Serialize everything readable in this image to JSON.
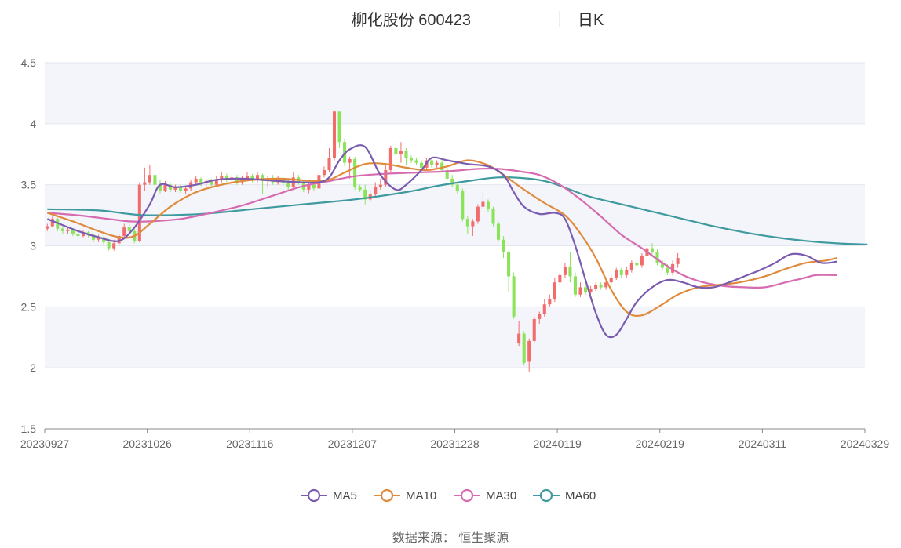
{
  "title": {
    "name": "柳化股份 600423",
    "period": "日K"
  },
  "source_text": "数据来源： 恒生聚源",
  "colors": {
    "up": "#F26C6C",
    "down": "#8BE35A",
    "ma5": "#7A5BB0",
    "ma10": "#E08A3C",
    "ma30": "#D66BB0",
    "ma60": "#3E9A9E",
    "band": "#F3F5FA",
    "grid": "#E2E6EE",
    "axis": "#888888"
  },
  "chart_data": {
    "type": "candlestick",
    "ylim": [
      1.5,
      4.5
    ],
    "yticks": [
      "1.5",
      "2",
      "2.5",
      "3",
      "3.5",
      "4",
      "4.5"
    ],
    "ytick_values": [
      1.5,
      2,
      2.5,
      3,
      3.5,
      4,
      4.5
    ],
    "xticks": [
      "20230927",
      "20231026",
      "20231116",
      "20231207",
      "20231228",
      "20240119",
      "20240219",
      "20240311",
      "20240329"
    ],
    "xtick_index": [
      0,
      20,
      40,
      60,
      80,
      100,
      120,
      140,
      160
    ],
    "legend": [
      "MA5",
      "MA10",
      "MA30",
      "MA60"
    ],
    "candles": [
      [
        3.14,
        3.16,
        3.12,
        3.18
      ],
      [
        3.16,
        3.22,
        3.15,
        3.24
      ],
      [
        3.22,
        3.14,
        3.12,
        3.23
      ],
      [
        3.14,
        3.12,
        3.1,
        3.16
      ],
      [
        3.12,
        3.13,
        3.1,
        3.15
      ],
      [
        3.13,
        3.1,
        3.08,
        3.14
      ],
      [
        3.1,
        3.08,
        3.06,
        3.12
      ],
      [
        3.08,
        3.11,
        3.07,
        3.13
      ],
      [
        3.11,
        3.09,
        3.07,
        3.12
      ],
      [
        3.09,
        3.05,
        3.03,
        3.1
      ],
      [
        3.05,
        3.07,
        3.03,
        3.09
      ],
      [
        3.07,
        3.03,
        3.01,
        3.08
      ],
      [
        3.03,
        2.98,
        2.96,
        3.05
      ],
      [
        2.98,
        3.02,
        2.96,
        3.05
      ],
      [
        3.02,
        3.08,
        3.0,
        3.1
      ],
      [
        3.08,
        3.15,
        3.06,
        3.18
      ],
      [
        3.15,
        3.12,
        3.1,
        3.18
      ],
      [
        3.12,
        3.04,
        3.02,
        3.14
      ],
      [
        3.04,
        3.5,
        3.03,
        3.52
      ],
      [
        3.5,
        3.52,
        3.45,
        3.64
      ],
      [
        3.52,
        3.58,
        3.5,
        3.66
      ],
      [
        3.58,
        3.5,
        3.48,
        3.62
      ],
      [
        3.5,
        3.45,
        3.43,
        3.54
      ],
      [
        3.45,
        3.5,
        3.44,
        3.53
      ],
      [
        3.5,
        3.46,
        3.44,
        3.52
      ],
      [
        3.46,
        3.48,
        3.44,
        3.5
      ],
      [
        3.48,
        3.45,
        3.43,
        3.5
      ],
      [
        3.45,
        3.47,
        3.42,
        3.49
      ],
      [
        3.47,
        3.52,
        3.45,
        3.54
      ],
      [
        3.52,
        3.55,
        3.5,
        3.57
      ],
      [
        3.55,
        3.51,
        3.49,
        3.56
      ],
      [
        3.51,
        3.53,
        3.49,
        3.55
      ],
      [
        3.53,
        3.5,
        3.48,
        3.55
      ],
      [
        3.5,
        3.54,
        3.49,
        3.57
      ],
      [
        3.54,
        3.57,
        3.52,
        3.6
      ],
      [
        3.57,
        3.54,
        3.52,
        3.59
      ],
      [
        3.54,
        3.56,
        3.52,
        3.58
      ],
      [
        3.56,
        3.52,
        3.5,
        3.58
      ],
      [
        3.52,
        3.55,
        3.5,
        3.57
      ],
      [
        3.55,
        3.57,
        3.53,
        3.6
      ],
      [
        3.57,
        3.54,
        3.52,
        3.59
      ],
      [
        3.54,
        3.58,
        3.52,
        3.6
      ],
      [
        3.58,
        3.53,
        3.42,
        3.59
      ],
      [
        3.53,
        3.55,
        3.48,
        3.57
      ],
      [
        3.55,
        3.52,
        3.5,
        3.58
      ],
      [
        3.52,
        3.55,
        3.5,
        3.57
      ],
      [
        3.55,
        3.51,
        3.49,
        3.56
      ],
      [
        3.51,
        3.48,
        3.46,
        3.54
      ],
      [
        3.48,
        3.56,
        3.46,
        3.6
      ],
      [
        3.56,
        3.52,
        3.5,
        3.58
      ],
      [
        3.52,
        3.46,
        3.44,
        3.54
      ],
      [
        3.46,
        3.5,
        3.43,
        3.52
      ],
      [
        3.5,
        3.47,
        3.45,
        3.53
      ],
      [
        3.47,
        3.58,
        3.46,
        3.6
      ],
      [
        3.58,
        3.62,
        3.56,
        3.65
      ],
      [
        3.62,
        3.72,
        3.6,
        3.8
      ],
      [
        3.72,
        4.1,
        3.7,
        4.11
      ],
      [
        4.1,
        3.85,
        3.8,
        4.1
      ],
      [
        3.85,
        3.68,
        3.65,
        3.88
      ],
      [
        3.68,
        3.71,
        3.55,
        3.73
      ],
      [
        3.71,
        3.48,
        3.46,
        3.73
      ],
      [
        3.48,
        3.46,
        3.44,
        3.5
      ],
      [
        3.46,
        3.38,
        3.34,
        3.5
      ],
      [
        3.38,
        3.42,
        3.36,
        3.45
      ],
      [
        3.42,
        3.48,
        3.4,
        3.52
      ],
      [
        3.48,
        3.5,
        3.46,
        3.55
      ],
      [
        3.5,
        3.62,
        3.48,
        3.66
      ],
      [
        3.62,
        3.8,
        3.6,
        3.82
      ],
      [
        3.8,
        3.75,
        3.74,
        3.85
      ],
      [
        3.75,
        3.78,
        3.68,
        3.85
      ],
      [
        3.78,
        3.72,
        3.66,
        3.8
      ],
      [
        3.72,
        3.7,
        3.68,
        3.74
      ],
      [
        3.7,
        3.68,
        3.66,
        3.72
      ],
      [
        3.68,
        3.64,
        3.62,
        3.7
      ],
      [
        3.64,
        3.7,
        3.62,
        3.72
      ],
      [
        3.7,
        3.66,
        3.64,
        3.72
      ],
      [
        3.66,
        3.68,
        3.64,
        3.7
      ],
      [
        3.68,
        3.62,
        3.6,
        3.7
      ],
      [
        3.62,
        3.55,
        3.53,
        3.64
      ],
      [
        3.55,
        3.5,
        3.48,
        3.58
      ],
      [
        3.5,
        3.45,
        3.43,
        3.52
      ],
      [
        3.45,
        3.22,
        3.2,
        3.47
      ],
      [
        3.22,
        3.16,
        3.1,
        3.24
      ],
      [
        3.16,
        3.2,
        3.08,
        3.22
      ],
      [
        3.2,
        3.32,
        3.18,
        3.34
      ],
      [
        3.32,
        3.36,
        3.3,
        3.45
      ],
      [
        3.36,
        3.3,
        3.28,
        3.38
      ],
      [
        3.3,
        3.18,
        3.16,
        3.32
      ],
      [
        3.18,
        3.05,
        3.03,
        3.2
      ],
      [
        3.05,
        2.95,
        2.9,
        3.08
      ],
      [
        2.95,
        2.75,
        2.62,
        2.96
      ],
      [
        2.75,
        2.42,
        2.4,
        2.78
      ],
      [
        2.2,
        2.28,
        2.18,
        2.38
      ],
      [
        2.28,
        2.04,
        2.02,
        2.3
      ],
      [
        2.05,
        2.22,
        1.97,
        2.24
      ],
      [
        2.22,
        2.4,
        2.2,
        2.42
      ],
      [
        2.4,
        2.44,
        2.36,
        2.46
      ],
      [
        2.44,
        2.52,
        2.42,
        2.56
      ],
      [
        2.52,
        2.56,
        2.5,
        2.6
      ],
      [
        2.56,
        2.7,
        2.54,
        2.74
      ],
      [
        2.7,
        2.76,
        2.68,
        2.78
      ],
      [
        2.76,
        2.83,
        2.74,
        2.86
      ],
      [
        2.83,
        2.75,
        2.7,
        2.95
      ],
      [
        2.75,
        2.6,
        2.58,
        2.78
      ],
      [
        2.6,
        2.66,
        2.58,
        2.7
      ],
      [
        2.66,
        2.62,
        2.6,
        2.68
      ],
      [
        2.62,
        2.65,
        2.6,
        2.67
      ],
      [
        2.65,
        2.68,
        2.63,
        2.7
      ],
      [
        2.68,
        2.66,
        2.64,
        2.7
      ],
      [
        2.66,
        2.7,
        2.64,
        2.72
      ],
      [
        2.7,
        2.74,
        2.68,
        2.77
      ],
      [
        2.74,
        2.8,
        2.72,
        2.82
      ],
      [
        2.8,
        2.76,
        2.74,
        2.82
      ],
      [
        2.76,
        2.8,
        2.74,
        2.83
      ],
      [
        2.8,
        2.86,
        2.78,
        2.88
      ],
      [
        2.86,
        2.84,
        2.82,
        2.89
      ],
      [
        2.84,
        2.92,
        2.82,
        2.94
      ],
      [
        2.92,
        2.98,
        2.9,
        3.0
      ],
      [
        2.98,
        2.95,
        2.92,
        3.02
      ],
      [
        2.95,
        2.86,
        2.84,
        2.97
      ],
      [
        2.86,
        2.82,
        2.8,
        2.88
      ],
      [
        2.82,
        2.78,
        2.76,
        2.85
      ],
      [
        2.78,
        2.85,
        2.76,
        2.88
      ],
      [
        2.85,
        2.9,
        2.82,
        2.94
      ]
    ],
    "ma5": [
      [
        0,
        3.22
      ],
      [
        6,
        3.12
      ],
      [
        10,
        3.07
      ],
      [
        14,
        3.04
      ],
      [
        17,
        3.15
      ],
      [
        20,
        3.34
      ],
      [
        22,
        3.5
      ],
      [
        25,
        3.48
      ],
      [
        29,
        3.5
      ],
      [
        33,
        3.54
      ],
      [
        38,
        3.55
      ],
      [
        45,
        3.53
      ],
      [
        50,
        3.52
      ],
      [
        53,
        3.52
      ],
      [
        55,
        3.56
      ],
      [
        57,
        3.7
      ],
      [
        59,
        3.79
      ],
      [
        62,
        3.81
      ],
      [
        65,
        3.58
      ],
      [
        68,
        3.46
      ],
      [
        70,
        3.5
      ],
      [
        73,
        3.62
      ],
      [
        75,
        3.72
      ],
      [
        78,
        3.7
      ],
      [
        82,
        3.67
      ],
      [
        86,
        3.65
      ],
      [
        89,
        3.58
      ],
      [
        91,
        3.44
      ],
      [
        93,
        3.32
      ],
      [
        96,
        3.26
      ],
      [
        99,
        3.27
      ],
      [
        101,
        3.22
      ],
      [
        103,
        3.0
      ],
      [
        105,
        2.72
      ],
      [
        107,
        2.45
      ],
      [
        109,
        2.27
      ],
      [
        111,
        2.27
      ],
      [
        113,
        2.4
      ],
      [
        115,
        2.54
      ],
      [
        118,
        2.66
      ],
      [
        121,
        2.72
      ],
      [
        124,
        2.7
      ],
      [
        127,
        2.66
      ],
      [
        130,
        2.66
      ],
      [
        133,
        2.7
      ],
      [
        136,
        2.75
      ],
      [
        139,
        2.8
      ],
      [
        142,
        2.86
      ],
      [
        145,
        2.93
      ],
      [
        148,
        2.92
      ],
      [
        151,
        2.86
      ],
      [
        154,
        2.87
      ]
    ],
    "ma10": [
      [
        0,
        3.27
      ],
      [
        5,
        3.2
      ],
      [
        10,
        3.12
      ],
      [
        14,
        3.07
      ],
      [
        17,
        3.08
      ],
      [
        20,
        3.18
      ],
      [
        24,
        3.32
      ],
      [
        28,
        3.42
      ],
      [
        32,
        3.48
      ],
      [
        38,
        3.53
      ],
      [
        45,
        3.55
      ],
      [
        52,
        3.53
      ],
      [
        55,
        3.54
      ],
      [
        58,
        3.6
      ],
      [
        62,
        3.67
      ],
      [
        66,
        3.67
      ],
      [
        70,
        3.64
      ],
      [
        74,
        3.62
      ],
      [
        78,
        3.65
      ],
      [
        82,
        3.7
      ],
      [
        86,
        3.66
      ],
      [
        89,
        3.58
      ],
      [
        93,
        3.46
      ],
      [
        97,
        3.35
      ],
      [
        101,
        3.25
      ],
      [
        104,
        3.1
      ],
      [
        107,
        2.9
      ],
      [
        110,
        2.64
      ],
      [
        113,
        2.46
      ],
      [
        116,
        2.43
      ],
      [
        120,
        2.52
      ],
      [
        123,
        2.6
      ],
      [
        127,
        2.66
      ],
      [
        131,
        2.68
      ],
      [
        135,
        2.7
      ],
      [
        140,
        2.75
      ],
      [
        144,
        2.81
      ],
      [
        148,
        2.86
      ],
      [
        152,
        2.88
      ],
      [
        154,
        2.9
      ]
    ],
    "ma30": [
      [
        0,
        3.27
      ],
      [
        6,
        3.25
      ],
      [
        12,
        3.22
      ],
      [
        16,
        3.2
      ],
      [
        20,
        3.2
      ],
      [
        26,
        3.22
      ],
      [
        32,
        3.27
      ],
      [
        38,
        3.33
      ],
      [
        44,
        3.41
      ],
      [
        50,
        3.49
      ],
      [
        55,
        3.53
      ],
      [
        60,
        3.57
      ],
      [
        66,
        3.59
      ],
      [
        72,
        3.6
      ],
      [
        78,
        3.61
      ],
      [
        84,
        3.63
      ],
      [
        88,
        3.63
      ],
      [
        92,
        3.61
      ],
      [
        96,
        3.58
      ],
      [
        100,
        3.5
      ],
      [
        104,
        3.38
      ],
      [
        108,
        3.24
      ],
      [
        112,
        3.09
      ],
      [
        116,
        2.98
      ],
      [
        120,
        2.86
      ],
      [
        124,
        2.76
      ],
      [
        128,
        2.7
      ],
      [
        132,
        2.67
      ],
      [
        136,
        2.66
      ],
      [
        140,
        2.66
      ],
      [
        144,
        2.7
      ],
      [
        148,
        2.74
      ],
      [
        150,
        2.76
      ],
      [
        154,
        2.76
      ]
    ],
    "ma60": [
      [
        0,
        3.3
      ],
      [
        10,
        3.29
      ],
      [
        16,
        3.26
      ],
      [
        20,
        3.25
      ],
      [
        30,
        3.26
      ],
      [
        40,
        3.3
      ],
      [
        50,
        3.34
      ],
      [
        60,
        3.38
      ],
      [
        70,
        3.44
      ],
      [
        76,
        3.49
      ],
      [
        82,
        3.53
      ],
      [
        88,
        3.56
      ],
      [
        94,
        3.55
      ],
      [
        98,
        3.52
      ],
      [
        102,
        3.46
      ],
      [
        106,
        3.4
      ],
      [
        112,
        3.34
      ],
      [
        118,
        3.28
      ],
      [
        124,
        3.22
      ],
      [
        130,
        3.16
      ],
      [
        136,
        3.11
      ],
      [
        142,
        3.07
      ],
      [
        148,
        3.04
      ],
      [
        154,
        3.02
      ],
      [
        160,
        3.01
      ]
    ]
  }
}
